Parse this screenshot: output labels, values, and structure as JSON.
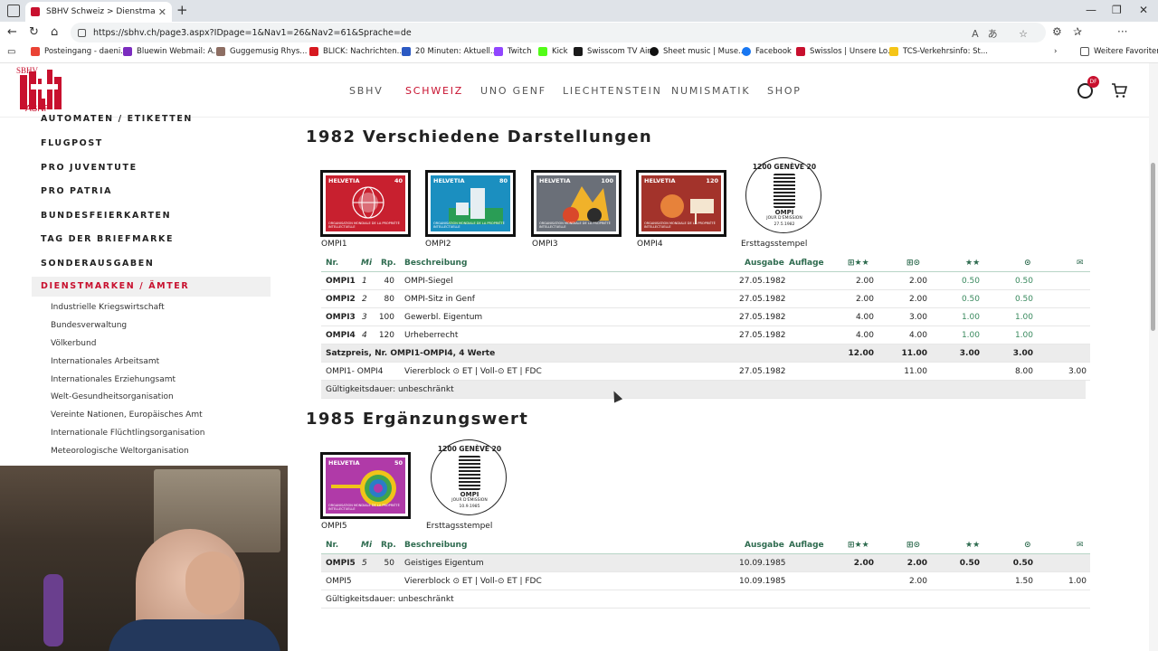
{
  "browser": {
    "tab_title": "SBHV Schweiz > Dienstmarken / Ä",
    "url": "https://sbhv.ch/page3.aspx?IDpage=1&Nav1=26&Nav2=61&Sprache=de",
    "bookmarks": [
      {
        "label": "Posteingang - daeni...",
        "color": "#ea4335"
      },
      {
        "label": "Bluewin Webmail: A...",
        "color": "#7b2cbf"
      },
      {
        "label": "Guggemusig Rhys...",
        "color": "#8d6e63"
      },
      {
        "label": "BLICK: Nachrichten...",
        "color": "#d71920"
      },
      {
        "label": "20 Minuten: Aktuell...",
        "color": "#2b59c3"
      },
      {
        "label": "Twitch",
        "color": "#9146ff"
      },
      {
        "label": "Kick",
        "color": "#53fc18"
      },
      {
        "label": "Swisscom TV Air",
        "color": "#1a1a1a"
      },
      {
        "label": "Sheet music | Muse...",
        "color": "#111111"
      },
      {
        "label": "Facebook",
        "color": "#1877f2"
      },
      {
        "label": "Swisslos | Unsere Lo...",
        "color": "#c8102e"
      },
      {
        "label": "TCS-Verkehrsinfo: St...",
        "color": "#f5c518"
      }
    ],
    "more_favorites": "Weitere Favoriten"
  },
  "site": {
    "logo_top": "SBHV",
    "logo_bottom": "ASNP",
    "nav": [
      "SBHV",
      "SCHWEIZ",
      "UNO GENF",
      "LIECHTENSTEIN",
      "NUMISMATIK",
      "SHOP"
    ],
    "nav_active": "SCHWEIZ",
    "user_badge": "DF"
  },
  "sidebar": {
    "main_items": [
      "AUTOMATEN / ETIKETTEN",
      "FLUGPOST",
      "PRO JUVENTUTE",
      "PRO PATRIA",
      "BUNDESFEIERKARTEN",
      "TAG DER BRIEFMARKE",
      "SONDERAUSGABEN"
    ],
    "active_item": "DIENSTMARKEN / ÄMTER",
    "sub_items": [
      "Industrielle Kriegswirtschaft",
      "Bundesverwaltung",
      "Völkerbund",
      "Internationales Arbeitsamt",
      "Internationales Erziehungsamt",
      "Welt-Gesundheitsorganisation",
      "Vereinte Nationen, Europäisches Amt",
      "Internationale Flüchtlingsorganisation",
      "Meteorologische Weltorganisation"
    ]
  },
  "headers": {
    "nr": "Nr.",
    "mi": "Mi",
    "rp": "Rp.",
    "desc": "Beschreibung",
    "ausgabe": "Ausgabe",
    "auflage": "Auflage",
    "c1": "⊞★★",
    "c2": "⊞⊙",
    "c3": "★★",
    "c4": "⊙",
    "c5": "✉"
  },
  "section1": {
    "title": "1982 Verschiedene Darstellungen",
    "stamps": [
      {
        "code": "OMPI1",
        "country": "HELVETIA",
        "value": "40",
        "org": "ORGANISATION MONDIALE DE LA PROPRIÉTÉ INTELLECTUELLE",
        "bg": "#c8202f"
      },
      {
        "code": "OMPI2",
        "country": "HELVETIA",
        "value": "80",
        "org": "ORGANISATION MONDIALE DE LA PROPRIÉTÉ INTELLECTUELLE",
        "bg": "#1b8fc0"
      },
      {
        "code": "OMPI3",
        "country": "HELVETIA",
        "value": "100",
        "org": "ORGANISATION MONDIALE DE LA PROPRIÉTÉ INTELLECTUELLE",
        "bg": "#6a6f78"
      },
      {
        "code": "OMPI4",
        "country": "HELVETIA",
        "value": "120",
        "org": "ORGANISATION MONDIALE DE LA PROPRIÉTÉ INTELLECTUELLE",
        "bg": "#a3332b"
      }
    ],
    "fdc": {
      "caption": "Ersttagsstempel",
      "top": "1200 GENÈVE 20",
      "ompi": "OMPI",
      "jour": "JOUR D'ÉMISSION",
      "date": "27.5.1982"
    },
    "rows": [
      {
        "nr": "OMPI1",
        "mi": "1",
        "rp": "40",
        "desc": "OMPI-Siegel",
        "ausgabe": "27.05.1982",
        "c1": "2.00",
        "c2": "2.00",
        "c3": "0.50",
        "c4": "0.50",
        "c5": ""
      },
      {
        "nr": "OMPI2",
        "mi": "2",
        "rp": "80",
        "desc": "OMPI-Sitz in Genf",
        "ausgabe": "27.05.1982",
        "c1": "2.00",
        "c2": "2.00",
        "c3": "0.50",
        "c4": "0.50",
        "c5": ""
      },
      {
        "nr": "OMPI3",
        "mi": "3",
        "rp": "100",
        "desc": "Gewerbl. Eigentum",
        "ausgabe": "27.05.1982",
        "c1": "4.00",
        "c2": "3.00",
        "c3": "1.00",
        "c4": "1.00",
        "c5": ""
      },
      {
        "nr": "OMPI4",
        "mi": "4",
        "rp": "120",
        "desc": "Urheberrecht",
        "ausgabe": "27.05.1982",
        "c1": "4.00",
        "c2": "4.00",
        "c3": "1.00",
        "c4": "1.00",
        "c5": ""
      }
    ],
    "satz": {
      "label": "Satzpreis, Nr. OMPI1-OMPI4, 4 Werte",
      "c1": "12.00",
      "c2": "11.00",
      "c3": "3.00",
      "c4": "3.00"
    },
    "block": {
      "nr": "OMPI1- OMPI4",
      "desc": "Viererblock ⊙ ET | Voll-⊙ ET | FDC",
      "ausgabe": "27.05.1982",
      "c2": "11.00",
      "c4": "8.00",
      "c5": "3.00"
    },
    "validity": "Gültigkeitsdauer: unbeschränkt"
  },
  "section2": {
    "title": "1985 Ergänzungswert",
    "stamp": {
      "code": "OMPI5",
      "country": "HELVETIA",
      "value": "50",
      "org": "ORGANISATION MONDIALE DE LA PROPRIÉTÉ INTELLECTUELLE",
      "bg": "#b03aa8"
    },
    "fdc": {
      "caption": "Ersttagsstempel",
      "top": "1200 GENÈVE 20",
      "ompi": "OMPI",
      "jour": "JOUR D'ÉMISSION",
      "date": "10.9.1985"
    },
    "row": {
      "nr": "OMPI5",
      "mi": "5",
      "rp": "50",
      "desc": "Geistiges Eigentum",
      "ausgabe": "10.09.1985",
      "c1": "2.00",
      "c2": "2.00",
      "c3": "0.50",
      "c4": "0.50",
      "c5": ""
    },
    "block": {
      "nr": "OMPI5",
      "desc": "Viererblock ⊙ ET | Voll-⊙ ET | FDC",
      "ausgabe": "10.09.1985",
      "c2": "2.00",
      "c4": "1.50",
      "c5": "1.00"
    },
    "validity": "Gültigkeitsdauer: unbeschränkt"
  }
}
